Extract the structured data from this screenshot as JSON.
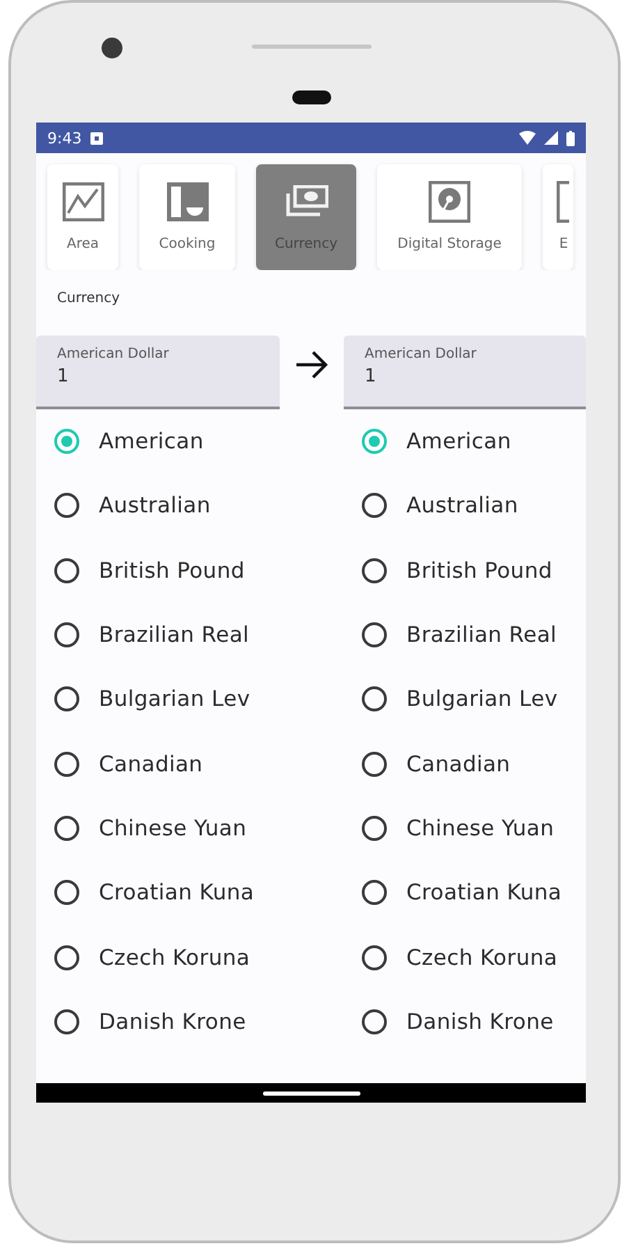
{
  "status_bar": {
    "time": "9:43"
  },
  "categories": [
    {
      "label": "Area",
      "selected": false
    },
    {
      "label": "Cooking",
      "selected": false
    },
    {
      "label": "Currency",
      "selected": true
    },
    {
      "label": "Digital Storage",
      "selected": false
    },
    {
      "label": "E",
      "selected": false
    }
  ],
  "section_label": "Currency",
  "from_field": {
    "label": "American Dollar",
    "value": "1"
  },
  "to_field": {
    "label": "American Dollar",
    "value": "1"
  },
  "from_options": [
    {
      "label": "American",
      "selected": true
    },
    {
      "label": "Australian",
      "selected": false
    },
    {
      "label": "British Pound",
      "selected": false
    },
    {
      "label": "Brazilian Real",
      "selected": false
    },
    {
      "label": "Bulgarian Lev",
      "selected": false
    },
    {
      "label": "Canadian",
      "selected": false
    },
    {
      "label": "Chinese Yuan",
      "selected": false
    },
    {
      "label": "Croatian Kuna",
      "selected": false
    },
    {
      "label": "Czech Koruna",
      "selected": false
    },
    {
      "label": "Danish Krone",
      "selected": false
    }
  ],
  "to_options": [
    {
      "label": "American",
      "selected": true
    },
    {
      "label": "Australian",
      "selected": false
    },
    {
      "label": "British Pound",
      "selected": false
    },
    {
      "label": "Brazilian Real",
      "selected": false
    },
    {
      "label": "Bulgarian Lev",
      "selected": false
    },
    {
      "label": "Canadian",
      "selected": false
    },
    {
      "label": "Chinese Yuan",
      "selected": false
    },
    {
      "label": "Croatian Kuna",
      "selected": false
    },
    {
      "label": "Czech Koruna",
      "selected": false
    },
    {
      "label": "Danish Krone",
      "selected": false
    }
  ]
}
